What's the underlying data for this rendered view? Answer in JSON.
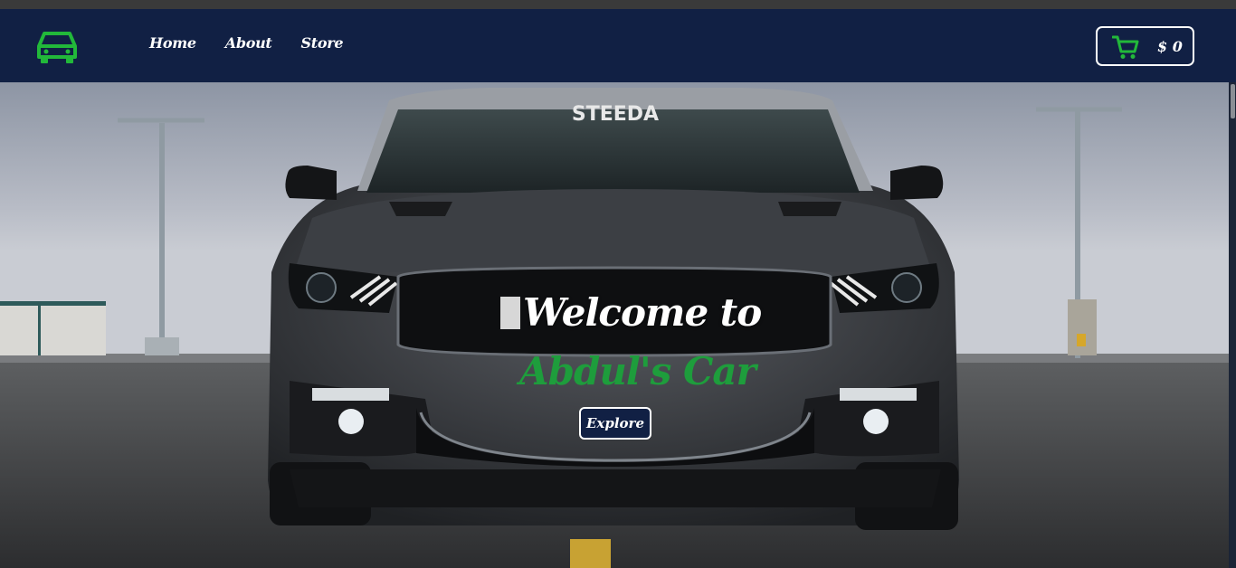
{
  "nav": {
    "logo_icon": "car-icon",
    "links": [
      {
        "label": "Home"
      },
      {
        "label": "About"
      },
      {
        "label": "Store"
      }
    ],
    "cart": {
      "icon": "shopping-cart-icon",
      "total": "$ 0"
    }
  },
  "hero": {
    "title": "Welcome to",
    "subtitle": "Abdul's Car",
    "button_label": "Explore",
    "windshield_banner": "STEEDA"
  },
  "colors": {
    "navbar": "#112044",
    "accent_green": "#22b83a",
    "subtitle_green": "#1e9d3c",
    "text": "#ffffff"
  }
}
